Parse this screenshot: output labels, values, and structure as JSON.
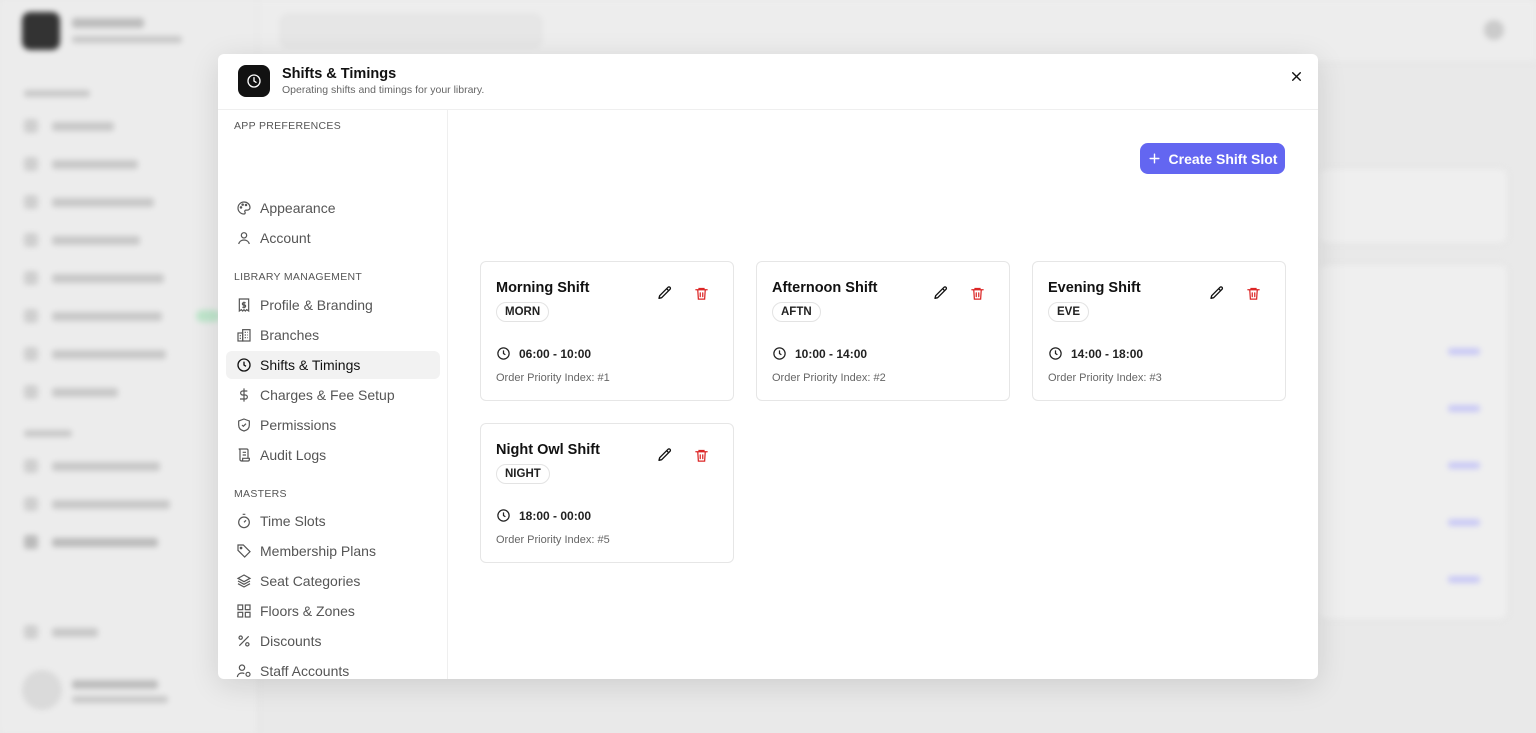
{
  "modal": {
    "icon": "clock-icon",
    "title": "Shifts & Timings",
    "subtitle": "Operating shifts and timings for your library.",
    "close_icon": "close-icon"
  },
  "nav": {
    "sections": [
      {
        "title": "APP PREFERENCES",
        "items": [
          {
            "label": "Appearance",
            "icon": "palette-icon"
          },
          {
            "label": "Account",
            "icon": "user-icon"
          }
        ]
      },
      {
        "title": "LIBRARY MANAGEMENT",
        "items": [
          {
            "label": "Profile & Branding",
            "icon": "receipt-icon"
          },
          {
            "label": "Branches",
            "icon": "building-icon"
          },
          {
            "label": "Shifts & Timings",
            "icon": "clock-icon",
            "active": true
          },
          {
            "label": "Charges & Fee Setup",
            "icon": "dollar-icon"
          },
          {
            "label": "Permissions",
            "icon": "shield-check-icon"
          },
          {
            "label": "Audit Logs",
            "icon": "scroll-icon"
          }
        ]
      },
      {
        "title": "MASTERS",
        "items": [
          {
            "label": "Time Slots",
            "icon": "timer-icon"
          },
          {
            "label": "Membership Plans",
            "icon": "tag-icon"
          },
          {
            "label": "Seat Categories",
            "icon": "layers-icon"
          },
          {
            "label": "Floors & Zones",
            "icon": "grid-icon"
          },
          {
            "label": "Discounts",
            "icon": "percent-icon"
          },
          {
            "label": "Staff Accounts",
            "icon": "user-cog-icon"
          }
        ]
      }
    ]
  },
  "toolbar": {
    "create_label": "Create Shift Slot",
    "create_icon": "plus-icon"
  },
  "shifts": [
    {
      "name": "Morning Shift",
      "code": "MORN",
      "time": "06:00 - 10:00",
      "priority": "Order Priority Index: #1"
    },
    {
      "name": "Afternoon Shift",
      "code": "AFTN",
      "time": "10:00 - 14:00",
      "priority": "Order Priority Index: #2"
    },
    {
      "name": "Evening Shift",
      "code": "EVE",
      "time": "14:00 - 18:00",
      "priority": "Order Priority Index: #3"
    },
    {
      "name": "Night Owl Shift",
      "code": "NIGHT",
      "time": "18:00 - 00:00",
      "priority": "Order Priority Index: #5"
    }
  ],
  "colors": {
    "accent": "#6366f1",
    "delete": "#dc2626",
    "modal_icon_bg": "#121212"
  }
}
